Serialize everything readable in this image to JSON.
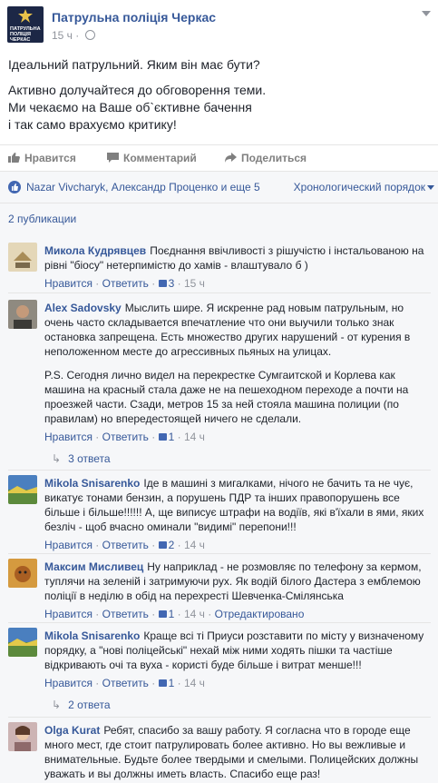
{
  "post": {
    "page_name": "Патрульна поліція Черкас",
    "avatar_text": "ПАТРУЛЬНА ПОЛІЦІЯ ЧЕРКАС",
    "time": "15 ч",
    "paragraphs": [
      "Ідеальний патрульний. Яким він має бути?",
      "Активно долучайтеся до обговорення теми.",
      "Ми чекаємо на Ваше об`єктивне бачення",
      "і так само врахуємо критику!"
    ]
  },
  "actions": {
    "like": "Нравится",
    "comment": "Комментарий",
    "share": "Поделиться"
  },
  "likes": {
    "text": "Nazar Vivcharyk, Александр Проценко и еще 5",
    "sort": "Хронологический порядок"
  },
  "publications": "2 публикации",
  "comments": [
    {
      "name": "Микола Кудрявцев",
      "text": "Поєднання ввічливості з рішучістю і інстальованою на рівні \"біосу\" нетерпимістю до хамів - влаштувало б )",
      "like": "Нравится",
      "reply": "Ответить",
      "likes": "3",
      "time": "15 ч",
      "avatar_color": "#d9c9a4"
    },
    {
      "name": "Alex Sadovsky",
      "text": "Мыслить шире. Я искренне рад новым патрульным, но очень часто складывается впечатление что они выучили только знак остановка запрещена. Есть множество других нарушений - от курения в неположенном месте до агрессивных пьяных на улицах.",
      "text2": "P.S. Сегодня лично видел на перекрестке Сумгаитской и Корлева как машина на красный стала даже не на пешеходном переходе а почти на проезжей части. Сзади, метров 15 за ней стояла машина полиции (по правилам) но впередестоящей ничего не сделали.",
      "like": "Нравится",
      "reply": "Ответить",
      "likes": "1",
      "time": "14 ч",
      "replies": "3 ответа",
      "avatar_color": "#6b5a4a"
    },
    {
      "name": "Mikola Snisarenko",
      "text": "Іде в машині з мигалками, нічого не бачить та не чує, викатує тонами бензин, а порушень ПДР та інших правопорушень все більше і більше!!!!!! А, ще виписує штрафи на водіїв, які в'їхали в ями, яких безліч - щоб вчасно оминали \"видимі\" перепони!!!",
      "like": "Нравится",
      "reply": "Ответить",
      "likes": "2",
      "time": "14 ч",
      "avatar_color": "#3f6a3a"
    },
    {
      "name": "Максим Мисливец",
      "text": "Ну наприклад - не розмовляє по телефону за кермом, туплячи на зеленій і затримуючи рух. Як водій білого Дастера з емблемою поліції в неділю в обід на перехресті Шевченка-Смілянська",
      "like": "Нравится",
      "reply": "Ответить",
      "likes": "1",
      "time": "14 ч",
      "edited": "Отредактировано",
      "avatar_color": "#c8862e"
    },
    {
      "name": "Mikola Snisarenko",
      "text": "Краще всі ті Приуси розставити по місту у визначеному порядку, а \"нові поліцейські\" нехай між ними ходять пішки та частіше відкривають очі та вуха - користі буде більше і витрат менше!!!",
      "like": "Нравится",
      "reply": "Ответить",
      "likes": "1",
      "time": "14 ч",
      "replies": "2 ответа",
      "avatar_color": "#3f6a3a"
    },
    {
      "name": "Olga Kurat",
      "text": "Ребят, спасибо за вашу работу. Я согласна что в городе еще много мест, где стоит патрулировать более активно. Но вы вежливые и внимательные. Будьте более твердыми и смелыми. Полицейских должны уважать и вы должны иметь власть. Спасибо еще раз!",
      "avatar_color": "#b99a9a"
    }
  ],
  "colors": {
    "link": "#365899",
    "meta": "#90949c",
    "bg_comments": "#f6f7f9"
  }
}
